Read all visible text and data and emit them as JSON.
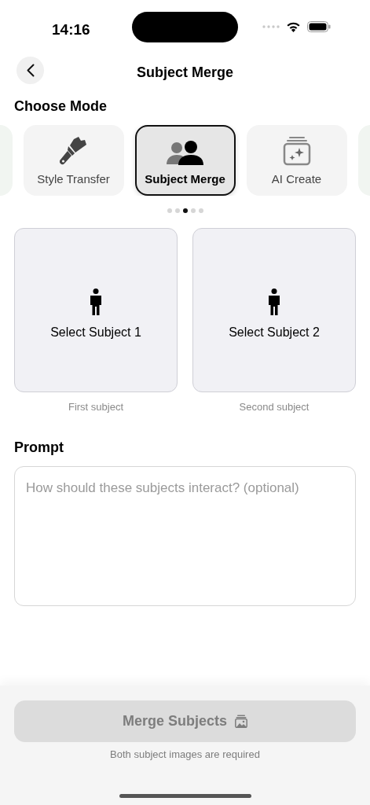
{
  "status_bar": {
    "time": "14:16"
  },
  "nav": {
    "title": "Subject Merge"
  },
  "mode_section": {
    "title": "Choose Mode"
  },
  "modes": [
    {
      "kind": "brush",
      "label": "Style Transfer",
      "selected": false
    },
    {
      "kind": "people",
      "label": "Subject Merge",
      "selected": true
    },
    {
      "kind": "sparkle",
      "label": "AI Create",
      "selected": false
    }
  ],
  "page_dots": [
    {
      "selected": false
    },
    {
      "selected": false
    },
    {
      "selected": true
    },
    {
      "selected": false
    },
    {
      "selected": false
    }
  ],
  "subjects": [
    {
      "label": "Select Subject 1",
      "caption": "First subject"
    },
    {
      "label": "Select Subject 2",
      "caption": "Second subject"
    }
  ],
  "prompt": {
    "title": "Prompt",
    "placeholder": "How should these subjects interact? (optional)"
  },
  "action": {
    "label": "Merge Subjects",
    "disabled": true,
    "note": "Both subject images are required"
  }
}
